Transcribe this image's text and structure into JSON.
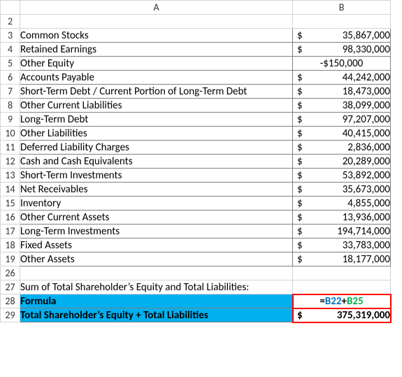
{
  "columns": {
    "a": "A",
    "b": "B"
  },
  "rows": [
    {
      "num": 2,
      "label": "",
      "value": "",
      "dollar": false,
      "style": "noborder"
    },
    {
      "num": 3,
      "label": "Common Stocks",
      "value": "35,867,000",
      "dollar": true,
      "style": "data"
    },
    {
      "num": 4,
      "label": "Retained Earnings",
      "value": "98,330,000",
      "dollar": true,
      "style": "data"
    },
    {
      "num": 5,
      "label": "Other Equity",
      "value": "-$150,000",
      "dollar": false,
      "style": "data",
      "center": true
    },
    {
      "num": 6,
      "label": "Accounts Payable",
      "value": "44,242,000",
      "dollar": true,
      "style": "data"
    },
    {
      "num": 7,
      "label": "Short-Term Debt / Current Portion of Long-Term Debt",
      "value": "18,473,000",
      "dollar": true,
      "style": "data"
    },
    {
      "num": 8,
      "label": "Other Current Liabilities",
      "value": "38,099,000",
      "dollar": true,
      "style": "data"
    },
    {
      "num": 9,
      "label": "Long-Term Debt",
      "value": "97,207,000",
      "dollar": true,
      "style": "data"
    },
    {
      "num": 10,
      "label": "Other Liabilities",
      "value": "40,415,000",
      "dollar": true,
      "style": "data"
    },
    {
      "num": 11,
      "label": "Deferred Liability Charges",
      "value": "2,836,000",
      "dollar": true,
      "style": "data"
    },
    {
      "num": 12,
      "label": "Cash and Cash Equivalents",
      "value": "20,289,000",
      "dollar": true,
      "style": "data"
    },
    {
      "num": 13,
      "label": "Short-Term Investments",
      "value": "53,892,000",
      "dollar": true,
      "style": "data"
    },
    {
      "num": 14,
      "label": "Net Receivables",
      "value": "35,673,000",
      "dollar": true,
      "style": "data"
    },
    {
      "num": 15,
      "label": "Inventory",
      "value": "4,855,000",
      "dollar": true,
      "style": "data"
    },
    {
      "num": 16,
      "label": "Other Current Assets",
      "value": "13,936,000",
      "dollar": true,
      "style": "data"
    },
    {
      "num": 17,
      "label": "Long-Term Investments",
      "value": "194,714,000",
      "dollar": true,
      "style": "data"
    },
    {
      "num": 18,
      "label": "Fixed Assets",
      "value": "33,783,000",
      "dollar": true,
      "style": "data"
    },
    {
      "num": 19,
      "label": "Other Assets",
      "value": "18,177,000",
      "dollar": true,
      "style": "data"
    }
  ],
  "gap": {
    "num": 26
  },
  "sumline": {
    "num": 27,
    "text": "Sum of Total Shareholder’s Equity and Total Liabilities:"
  },
  "formula_row": {
    "num": 28,
    "label": "Formula",
    "eq": "=",
    "ref1": "B22",
    "plus": "+",
    "ref2": "B25"
  },
  "total_row": {
    "num": 29,
    "label": "Total Shareholder’s Equity + Total Liabilities",
    "value": "375,319,000"
  },
  "chart_data": {
    "type": "table",
    "title": "Balance Sheet Items and Total",
    "items": [
      {
        "label": "Common Stocks",
        "value": 35867000
      },
      {
        "label": "Retained Earnings",
        "value": 98330000
      },
      {
        "label": "Other Equity",
        "value": -150000
      },
      {
        "label": "Accounts Payable",
        "value": 44242000
      },
      {
        "label": "Short-Term Debt / Current Portion of Long-Term Debt",
        "value": 18473000
      },
      {
        "label": "Other Current Liabilities",
        "value": 38099000
      },
      {
        "label": "Long-Term Debt",
        "value": 97207000
      },
      {
        "label": "Other Liabilities",
        "value": 40415000
      },
      {
        "label": "Deferred Liability Charges",
        "value": 2836000
      },
      {
        "label": "Cash and Cash Equivalents",
        "value": 20289000
      },
      {
        "label": "Short-Term Investments",
        "value": 53892000
      },
      {
        "label": "Net Receivables",
        "value": 35673000
      },
      {
        "label": "Inventory",
        "value": 4855000
      },
      {
        "label": "Other Current Assets",
        "value": 13936000
      },
      {
        "label": "Long-Term Investments",
        "value": 194714000
      },
      {
        "label": "Fixed Assets",
        "value": 33783000
      },
      {
        "label": "Other Assets",
        "value": 18177000
      }
    ],
    "formula": "=B22+B25",
    "total": {
      "label": "Total Shareholder’s Equity + Total Liabilities",
      "value": 375319000
    }
  }
}
